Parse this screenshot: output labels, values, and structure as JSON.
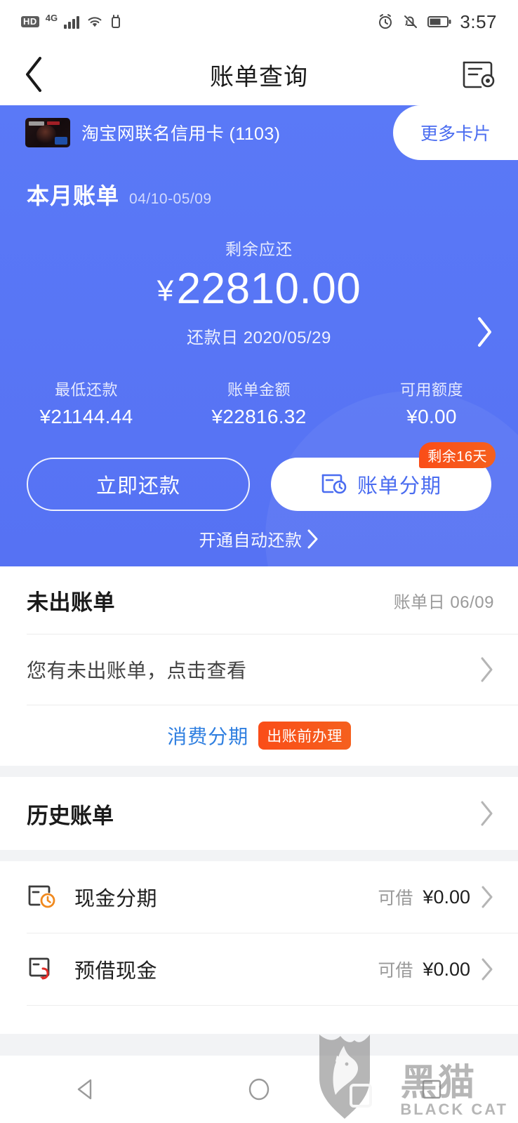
{
  "status_bar": {
    "hd_label": "HD",
    "network_label": "4G",
    "time": "3:57",
    "icons": [
      "hd-icon",
      "signal-icon",
      "wifi-icon",
      "usb-icon",
      "alarm-icon",
      "mute-icon",
      "battery-icon"
    ]
  },
  "nav": {
    "title": "账单查询",
    "back_icon": "chevron-left-icon",
    "settings_icon": "bill-settings-icon"
  },
  "card_bar": {
    "card_name": "淘宝网联名信用卡 (1103)",
    "more_cards": "更多卡片"
  },
  "hero": {
    "bill_title": "本月账单",
    "bill_period": "04/10-05/09",
    "amount_label": "剩余应还",
    "currency": "¥",
    "amount_value": "22810.00",
    "due_date": "还款日 2020/05/29",
    "arrow_icon": "chevron-right-icon",
    "stats": [
      {
        "label": "最低还款",
        "value": "¥21144.44"
      },
      {
        "label": "账单金额",
        "value": "¥22816.32"
      },
      {
        "label": "可用额度",
        "value": "¥0.00"
      }
    ],
    "repay_button": "立即还款",
    "installment_button": "账单分期",
    "installment_badge": "剩余16天",
    "autopay_link": "开通自动还款",
    "autopay_arrow": "›",
    "accent_blue": "#5672f3",
    "badge_orange": "#fa4d18"
  },
  "unbilled": {
    "title": "未出账单",
    "bill_day": "账单日 06/09",
    "row_text": "您有未出账单，点击查看",
    "row_arrow": "chevron-right-icon",
    "promo_link": "消费分期",
    "promo_badge": "出账前办理",
    "promo_link_color": "#2f7fe0"
  },
  "history": {
    "title": "历史账单",
    "arrow": "chevron-right-icon"
  },
  "services": [
    {
      "label": "现金分期",
      "icon": "cash-installment-icon",
      "tag": "可借",
      "amount": "¥0.00",
      "arrow": "chevron-right-icon"
    },
    {
      "label": "预借现金",
      "icon": "cash-advance-icon",
      "tag": "可借",
      "amount": "¥0.00",
      "arrow": "chevron-right-icon"
    }
  ],
  "android_nav": {
    "back": "back-triangle-icon",
    "home": "home-circle-icon",
    "recents": "recents-square-icon"
  },
  "watermark": {
    "cn": "黑猫",
    "en": "BLACK CAT"
  }
}
